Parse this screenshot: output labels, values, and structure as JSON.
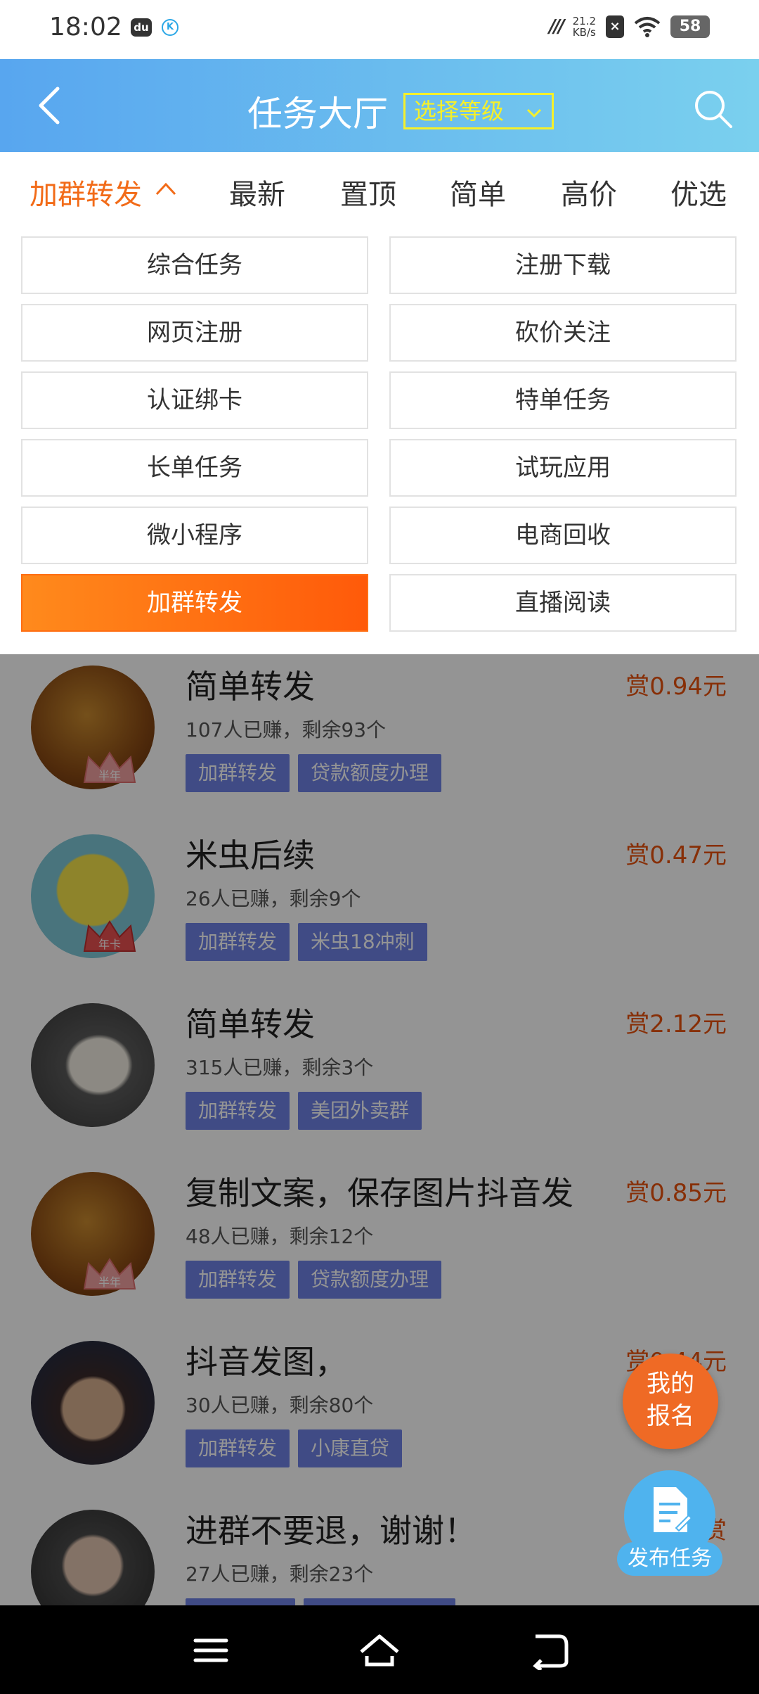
{
  "status_bar": {
    "time": "18:02",
    "speed_top": "21.2",
    "speed_bottom": "KB/s",
    "battery": "58",
    "icons": [
      "bear-app-icon",
      "k-app-icon",
      "signal-icon",
      "x-notification-icon",
      "wifi-icon",
      "battery-icon"
    ]
  },
  "header": {
    "title": "任务大厅",
    "level_select": "选择等级",
    "accent_color": "#f5f02a"
  },
  "tabs": [
    {
      "label": "加群转发",
      "active": true
    },
    {
      "label": "最新"
    },
    {
      "label": "置顶"
    },
    {
      "label": "简单"
    },
    {
      "label": "高价"
    },
    {
      "label": "优选"
    }
  ],
  "categories": [
    "综合任务",
    "注册下载",
    "网页注册",
    "砍价关注",
    "认证绑卡",
    "特单任务",
    "长单任务",
    "试玩应用",
    "微小程序",
    "电商回收",
    "加群转发",
    "直播阅读"
  ],
  "selected_category": "加群转发",
  "tasks": [
    {
      "title": "简单转发",
      "meta": "107人已赚，剩余93个",
      "reward": "赏0.94元",
      "tags": [
        "加群转发",
        "贷款额度办理"
      ],
      "badge": "半年"
    },
    {
      "title": "米虫后续",
      "meta": "26人已赚，剩余9个",
      "reward": "赏0.47元",
      "tags": [
        "加群转发",
        "米虫18冲刺"
      ],
      "badge": "年卡"
    },
    {
      "title": "简单转发",
      "meta": "315人已赚，剩余3个",
      "reward": "赏2.12元",
      "tags": [
        "加群转发",
        "美团外卖群"
      ],
      "badge": ""
    },
    {
      "title": "复制文案，保存图片抖音发",
      "meta": "48人已赚，剩余12个",
      "reward": "赏0.85元",
      "tags": [
        "加群转发",
        "贷款额度办理"
      ],
      "badge": "半年"
    },
    {
      "title": "抖音发图，",
      "meta": "30人已赚，剩余80个",
      "reward": "赏0.44元",
      "tags": [
        "加群转发",
        "小康直贷"
      ],
      "badge": ""
    },
    {
      "title": "进群不要退，谢谢！",
      "meta": "27人已赚，剩余23个",
      "reward": "赏",
      "tags": [
        "",
        ""
      ],
      "badge": ""
    }
  ],
  "fab": {
    "signup_line1": "我的",
    "signup_line2": "报名",
    "publish": "发布任务"
  },
  "nav": [
    "menu-icon",
    "home-icon",
    "back-nav-icon"
  ]
}
